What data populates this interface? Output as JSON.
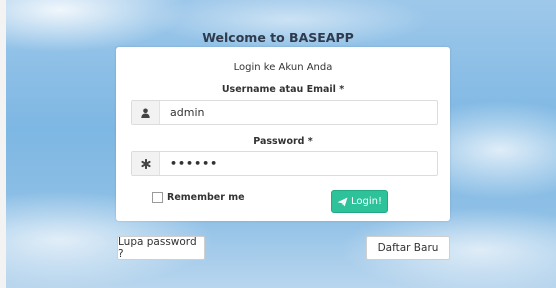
{
  "header": {
    "welcome": "Welcome to BASEAPP"
  },
  "login_card": {
    "subtitle": "Login ke Akun Anda",
    "username": {
      "label": "Username atau Email *",
      "value": "admin",
      "icon": "user-icon"
    },
    "password": {
      "label": "Password *",
      "value": "••••••",
      "icon": "asterisk-icon"
    },
    "remember_label": "Remember me",
    "remember_checked": false,
    "login_button": {
      "label": "Login!",
      "icon": "paper-plane-icon",
      "color": "#2ec29a"
    }
  },
  "footer_buttons": {
    "forgot_password": "Lupa password ?",
    "register": "Daftar Baru"
  }
}
